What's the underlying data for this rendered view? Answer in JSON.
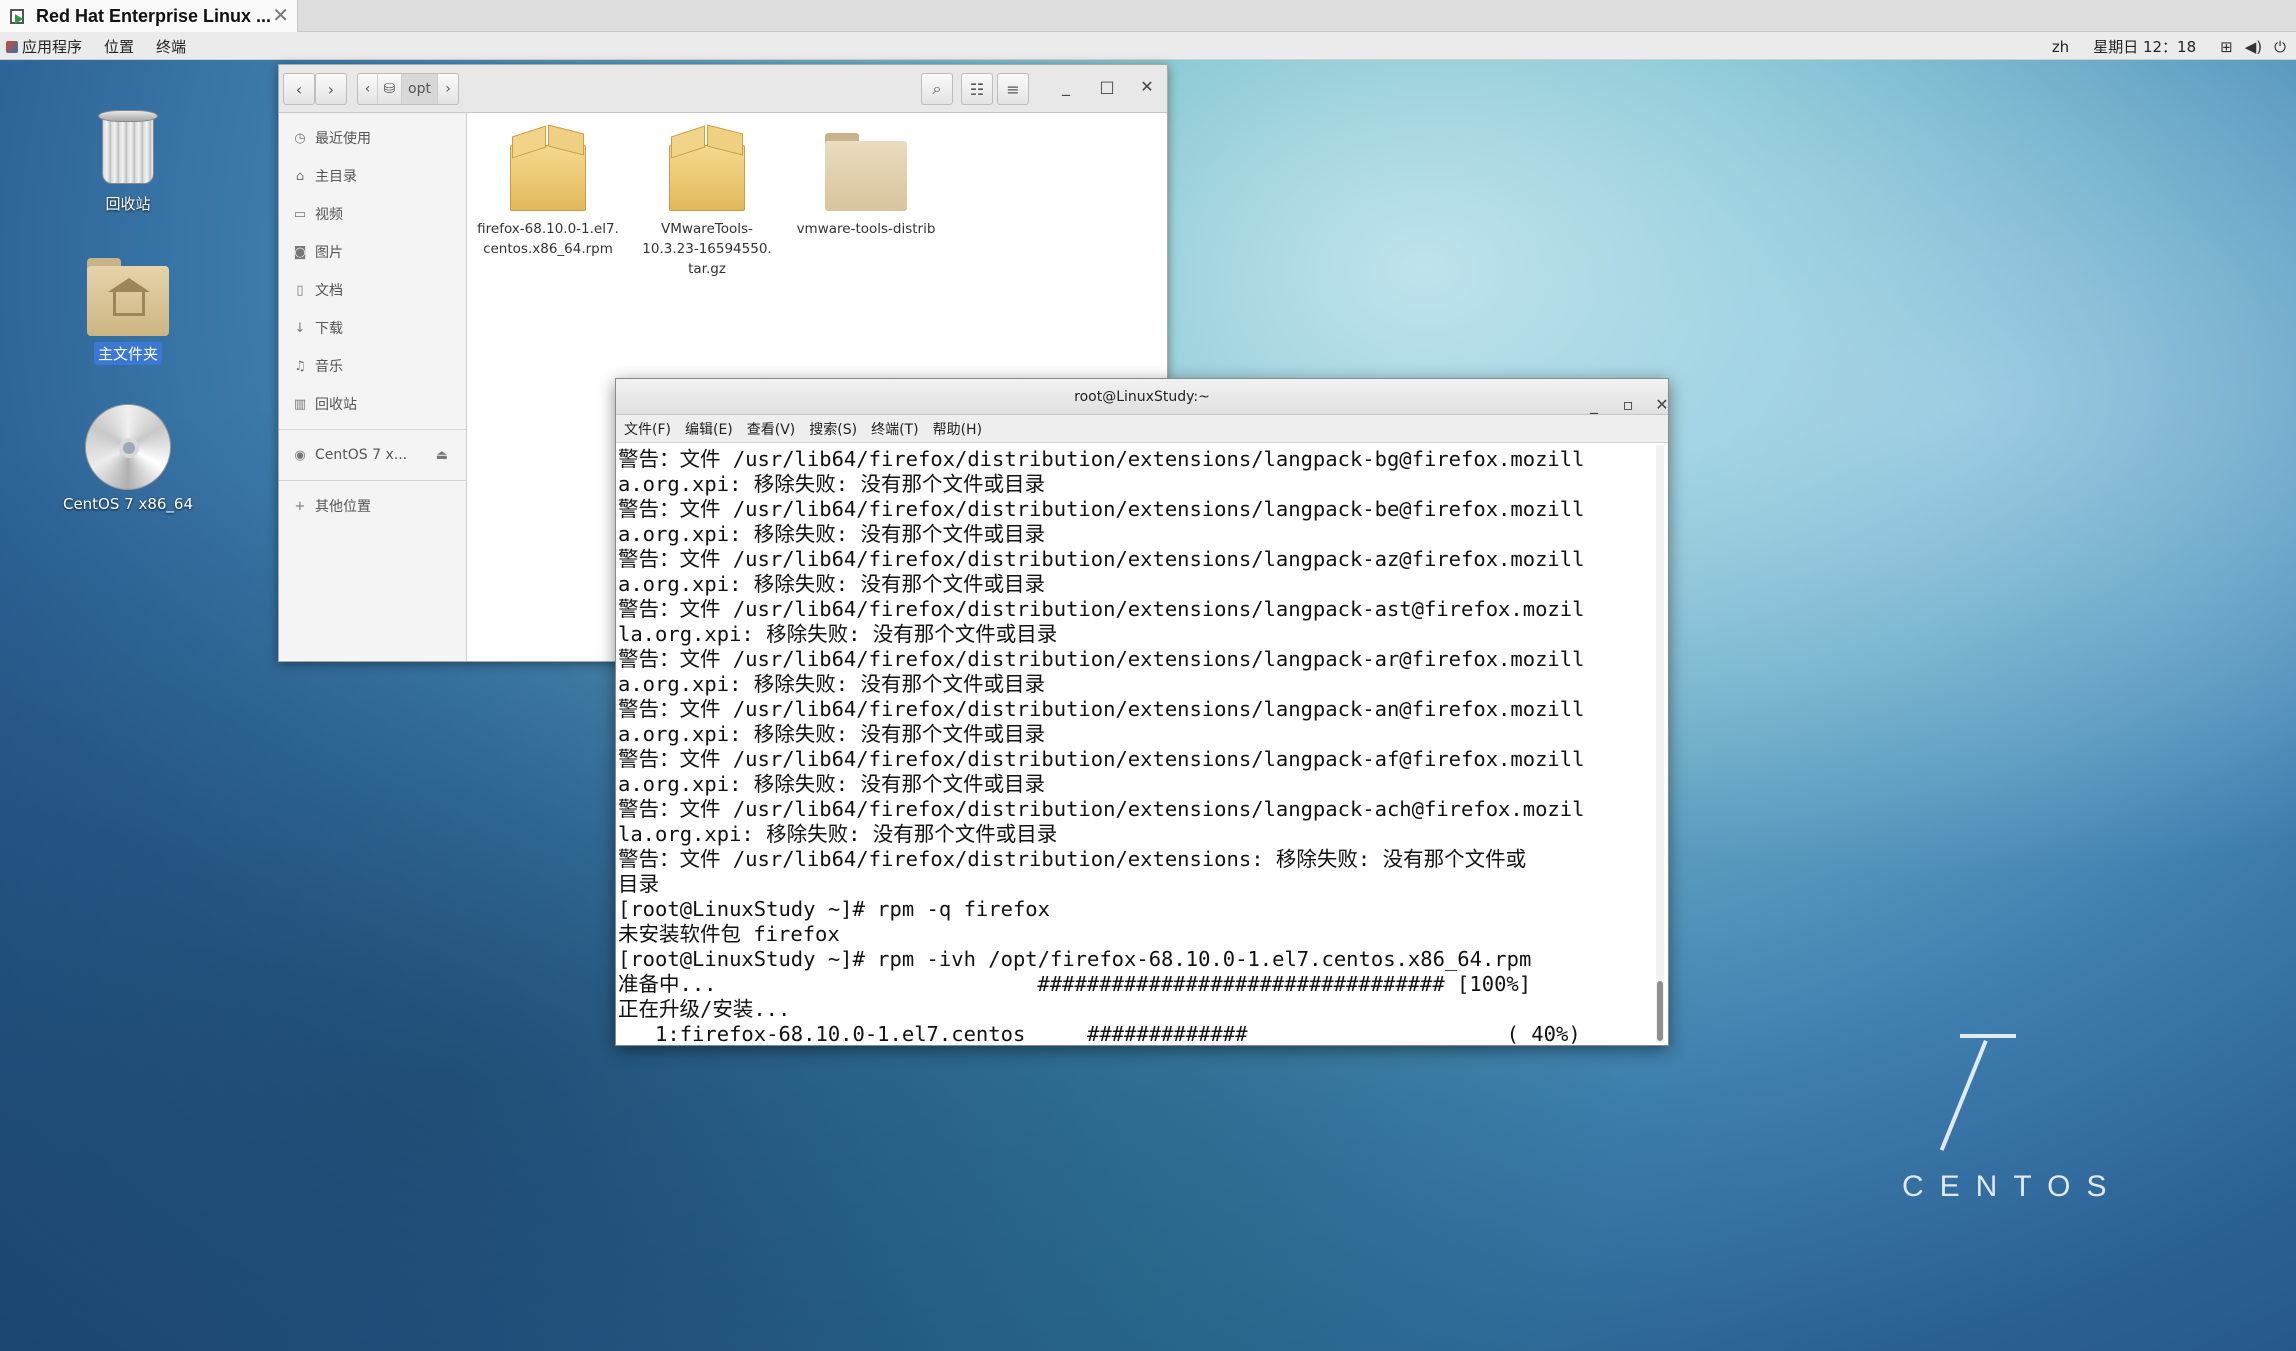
{
  "host": {
    "tab_title": "Red Hat Enterprise Linux ..."
  },
  "topbar": {
    "apps": "应用程序",
    "places": "位置",
    "terminal": "终端",
    "lang": "zh",
    "clock": "星期日 12：18"
  },
  "desktop": {
    "trash": "回收站",
    "home": "主文件夹",
    "disc": "CentOS 7 x86_64"
  },
  "file_manager": {
    "path_crumb": "opt",
    "sidebar": {
      "recent": "最近使用",
      "home": "主目录",
      "videos": "视频",
      "pictures": "图片",
      "documents": "文档",
      "downloads": "下载",
      "music": "音乐",
      "trash": "回收站",
      "device": "CentOS 7 x...",
      "other": "其他位置"
    },
    "files": {
      "f1_l1": "firefox-68.10.0-1.el7.",
      "f1_l2": "centos.x86_64.rpm",
      "f2_l1": "VMwareTools-",
      "f2_l2": "10.3.23-16594550.",
      "f2_l3": "tar.gz",
      "f3_l1": "vmware-tools-distrib"
    }
  },
  "terminal": {
    "title": "root@LinuxStudy:~",
    "menu": {
      "file": "文件(F)",
      "edit": "编辑(E)",
      "view": "查看(V)",
      "search": "搜索(S)",
      "terminal": "终端(T)",
      "help": "帮助(H)"
    },
    "lines": [
      "警告：文件 /usr/lib64/firefox/distribution/extensions/langpack-bg@firefox.mozill",
      "a.org.xpi: 移除失败: 没有那个文件或目录",
      "警告：文件 /usr/lib64/firefox/distribution/extensions/langpack-be@firefox.mozill",
      "a.org.xpi: 移除失败: 没有那个文件或目录",
      "警告：文件 /usr/lib64/firefox/distribution/extensions/langpack-az@firefox.mozill",
      "a.org.xpi: 移除失败: 没有那个文件或目录",
      "警告：文件 /usr/lib64/firefox/distribution/extensions/langpack-ast@firefox.mozil",
      "la.org.xpi: 移除失败: 没有那个文件或目录",
      "警告：文件 /usr/lib64/firefox/distribution/extensions/langpack-ar@firefox.mozill",
      "a.org.xpi: 移除失败: 没有那个文件或目录",
      "警告：文件 /usr/lib64/firefox/distribution/extensions/langpack-an@firefox.mozill",
      "a.org.xpi: 移除失败: 没有那个文件或目录",
      "警告：文件 /usr/lib64/firefox/distribution/extensions/langpack-af@firefox.mozill",
      "a.org.xpi: 移除失败: 没有那个文件或目录",
      "警告：文件 /usr/lib64/firefox/distribution/extensions/langpack-ach@firefox.mozil",
      "la.org.xpi: 移除失败: 没有那个文件或目录",
      "警告：文件 /usr/lib64/firefox/distribution/extensions: 移除失败: 没有那个文件或",
      "目录",
      "[root@LinuxStudy ~]# rpm -q firefox",
      "未安装软件包 firefox",
      "[root@LinuxStudy ~]# rpm -ivh /opt/firefox-68.10.0-1.el7.centos.x86_64.rpm",
      "准备中...                          ################################# [100%]",
      "正在升级/安装...",
      "   1:firefox-68.10.0-1.el7.centos     #############                     ( 40%)"
    ]
  },
  "brand": {
    "version": "7",
    "word": "CENTOS"
  }
}
